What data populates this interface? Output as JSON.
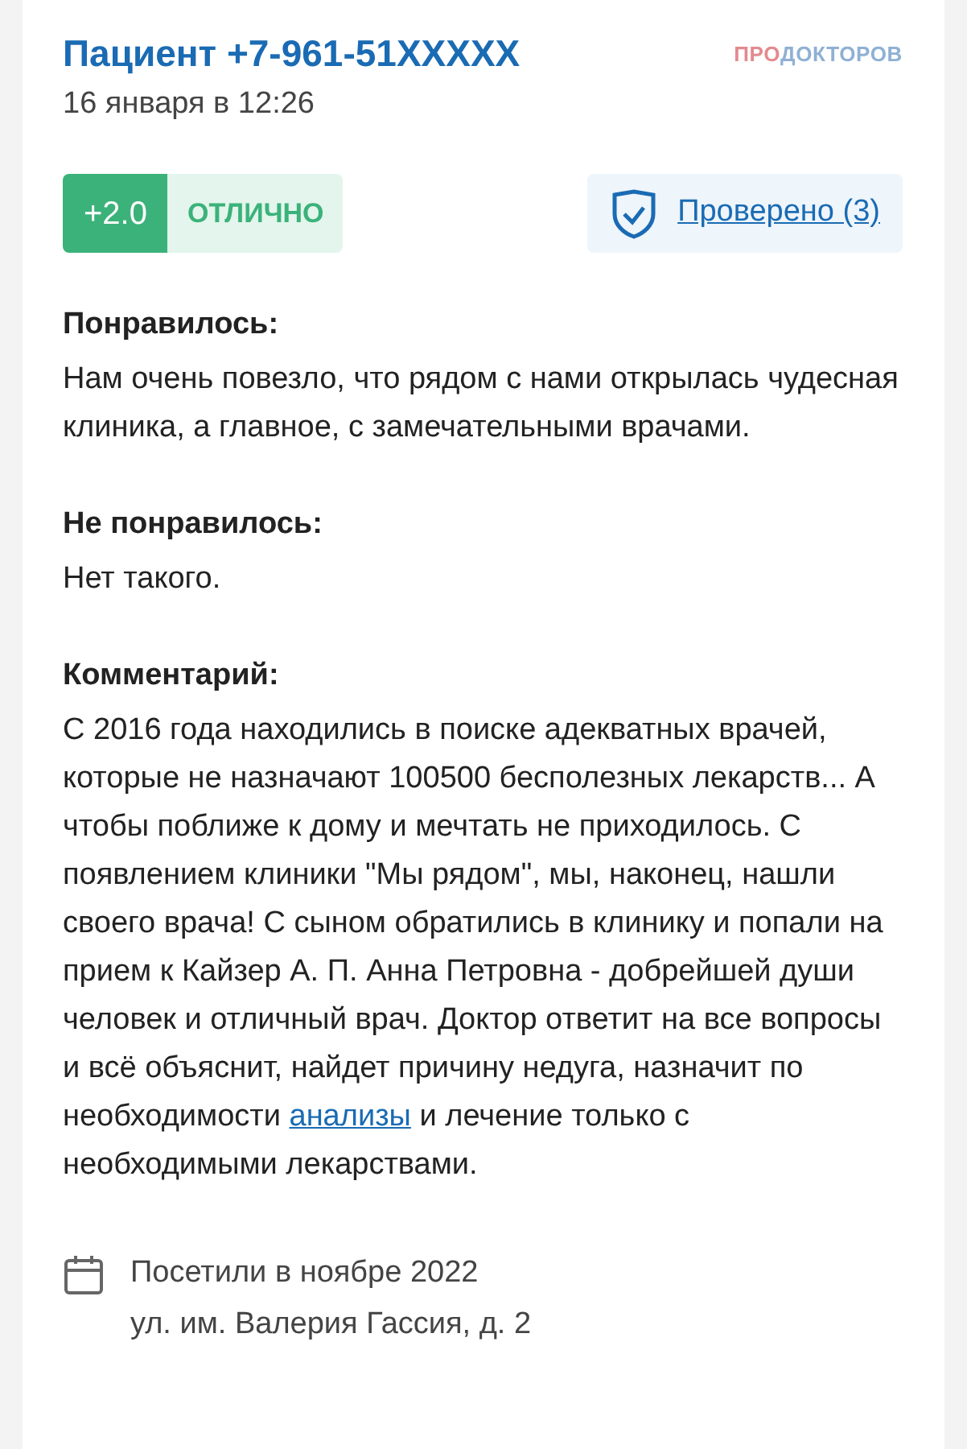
{
  "review": {
    "author": "Пациент +7-961-51XXXXX",
    "date": "16 января в 12:26",
    "logo": {
      "part_1": "ПРО",
      "part_2": "ДОКТОРОВ"
    },
    "rating": {
      "score": "+2.0",
      "label": "ОТЛИЧНО"
    },
    "verified": {
      "label": "Проверено (3)"
    },
    "sections": [
      {
        "heading": "Понравилось:",
        "text": "Нам очень повезло, что рядом с нами открылась чудесная клиника, а главное, с замечательными врачами."
      },
      {
        "heading": "Не понравилось:",
        "text": "Нет такого."
      },
      {
        "heading": "Комментарий:",
        "text": "С 2016 года находились в поиске адекватных врачей, которые не назначают 100500 бесполезных лекарств... А чтобы поближе к дому и мечтать не приходилось. С появлением клиники \"Мы рядом\", мы, наконец, нашли своего врача! С сыном обратились в клинику и попали на прием к Кайзер А. П. Анна Петровна - добрейшей души человек и отличный врач. Доктор ответит на все вопросы и всё объяснит, найдет причину недуга, назначит по необходимости ",
        "link": "анализы",
        "text_after": " и лечение только с необходимыми лекарствами."
      }
    ],
    "visit": {
      "date": "Посетили в ноябре 2022",
      "address": "ул. им. Валерия Гассия, д. 2"
    }
  }
}
